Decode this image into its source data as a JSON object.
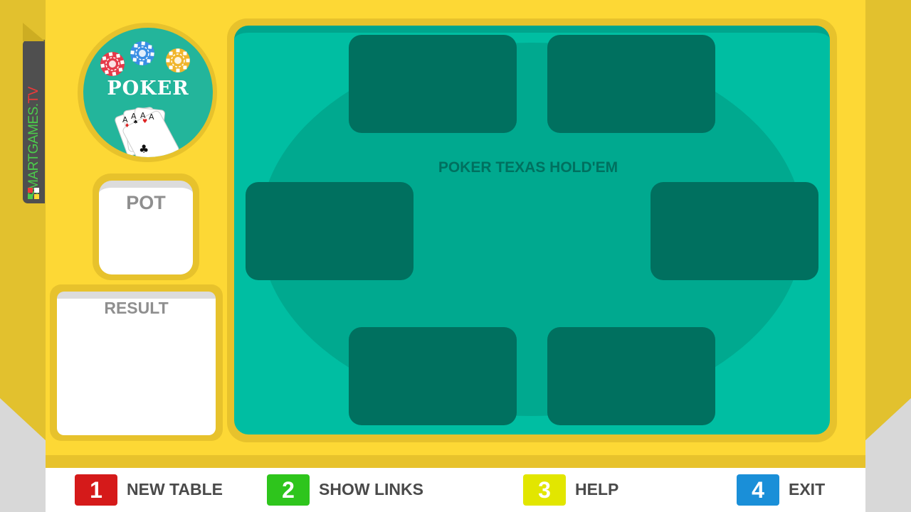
{
  "brand": {
    "main": "SMARTGAMES.",
    "tv": "TV",
    "colors": {
      "main": "#4ccc4c",
      "tv": "#ee3a3a"
    }
  },
  "logo": {
    "title": "POKER",
    "chips": [
      "#e53a4a",
      "#3a8fe5",
      "#f0b52b"
    ]
  },
  "pot": {
    "label": "POT",
    "value": ""
  },
  "result": {
    "label": "RESULT",
    "text": ""
  },
  "table": {
    "title": "POKER TEXAS HOLD'EM",
    "seats": [
      "",
      "",
      "",
      "",
      "",
      ""
    ]
  },
  "menu": [
    {
      "key": "1",
      "label": "NEW TABLE",
      "color": "#d51a1a"
    },
    {
      "key": "2",
      "label": "SHOW LINKS",
      "color": "#2ec51c"
    },
    {
      "key": "3",
      "label": "HELP",
      "color": "#e2e600"
    },
    {
      "key": "4",
      "label": "EXIT",
      "color": "#1a8fd8"
    }
  ]
}
